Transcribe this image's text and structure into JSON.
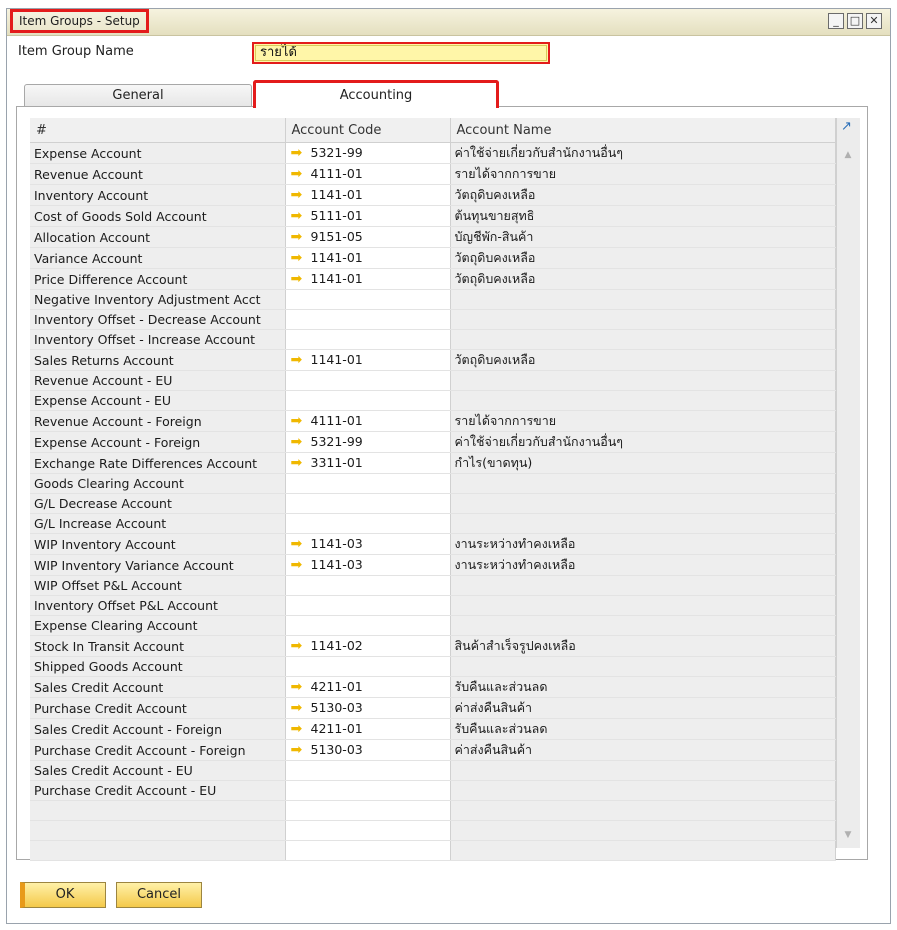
{
  "window": {
    "title": "Item Groups - Setup",
    "minimize": "_",
    "maximize": "□",
    "close": "✕"
  },
  "form": {
    "item_group_name_label": "Item Group Name",
    "item_group_name_value": "รายได้"
  },
  "tabs": [
    {
      "label": "General"
    },
    {
      "label": "Accounting"
    }
  ],
  "table": {
    "headers": [
      "#",
      "Account Code",
      "Account Name"
    ],
    "rows": [
      {
        "name": "Expense Account",
        "code": "5321-99",
        "desc": "ค่าใช้จ่ายเกี่ยวกับสำนักงานอื่นๆ"
      },
      {
        "name": "Revenue Account",
        "code": "4111-01",
        "desc": "รายได้จากการขาย"
      },
      {
        "name": "Inventory Account",
        "code": "1141-01",
        "desc": "วัตถุดิบคงเหลือ"
      },
      {
        "name": "Cost of Goods Sold Account",
        "code": "5111-01",
        "desc": "ต้นทุนขายสุทธิ"
      },
      {
        "name": "Allocation Account",
        "code": "9151-05",
        "desc": "บัญชีพัก-สินค้า"
      },
      {
        "name": "Variance Account",
        "code": "1141-01",
        "desc": "วัตถุดิบคงเหลือ"
      },
      {
        "name": "Price Difference Account",
        "code": "1141-01",
        "desc": "วัตถุดิบคงเหลือ"
      },
      {
        "name": "Negative Inventory Adjustment Acct",
        "code": "",
        "desc": ""
      },
      {
        "name": "Inventory Offset - Decrease Account",
        "code": "",
        "desc": ""
      },
      {
        "name": "Inventory Offset - Increase Account",
        "code": "",
        "desc": ""
      },
      {
        "name": "Sales Returns Account",
        "code": "1141-01",
        "desc": "วัตถุดิบคงเหลือ"
      },
      {
        "name": "Revenue Account - EU",
        "code": "",
        "desc": ""
      },
      {
        "name": "Expense Account - EU",
        "code": "",
        "desc": ""
      },
      {
        "name": "Revenue Account - Foreign",
        "code": "4111-01",
        "desc": "รายได้จากการขาย"
      },
      {
        "name": "Expense Account - Foreign",
        "code": "5321-99",
        "desc": "ค่าใช้จ่ายเกี่ยวกับสำนักงานอื่นๆ"
      },
      {
        "name": "Exchange Rate Differences Account",
        "code": "3311-01",
        "desc": "กำไร(ขาดทุน)"
      },
      {
        "name": "Goods Clearing Account",
        "code": "",
        "desc": ""
      },
      {
        "name": "G/L Decrease Account",
        "code": "",
        "desc": ""
      },
      {
        "name": "G/L Increase Account",
        "code": "",
        "desc": ""
      },
      {
        "name": "WIP Inventory Account",
        "code": "1141-03",
        "desc": "งานระหว่างทำคงเหลือ"
      },
      {
        "name": "WIP Inventory Variance Account",
        "code": "1141-03",
        "desc": "งานระหว่างทำคงเหลือ"
      },
      {
        "name": "WIP Offset P&L Account",
        "code": "",
        "desc": ""
      },
      {
        "name": "Inventory Offset P&L Account",
        "code": "",
        "desc": ""
      },
      {
        "name": "Expense Clearing Account",
        "code": "",
        "desc": ""
      },
      {
        "name": "Stock In Transit Account",
        "code": "1141-02",
        "desc": "สินค้าสำเร็จรูปคงเหลือ"
      },
      {
        "name": "Shipped Goods Account",
        "code": "",
        "desc": ""
      },
      {
        "name": "Sales Credit Account",
        "code": "4211-01",
        "desc": "รับคืนและส่วนลด"
      },
      {
        "name": "Purchase Credit Account",
        "code": "5130-03",
        "desc": "ค่าส่งคืนสินค้า"
      },
      {
        "name": "Sales Credit Account - Foreign",
        "code": "4211-01",
        "desc": "รับคืนและส่วนลด"
      },
      {
        "name": "Purchase Credit Account - Foreign",
        "code": "5130-03",
        "desc": "ค่าส่งคืนสินค้า"
      },
      {
        "name": "Sales Credit Account - EU",
        "code": "",
        "desc": ""
      },
      {
        "name": "Purchase Credit Account - EU",
        "code": "",
        "desc": ""
      },
      {
        "name": "",
        "code": "",
        "desc": ""
      },
      {
        "name": "",
        "code": "",
        "desc": ""
      },
      {
        "name": "",
        "code": "",
        "desc": ""
      }
    ]
  },
  "buttons": {
    "ok": "OK",
    "cancel": "Cancel"
  },
  "icons": {
    "link_arrow": "yellow-right-arrow-icon",
    "expand": "expand-icon"
  },
  "colors": {
    "highlight_red": "#e31b1b",
    "input_yellow": "#fff6a8",
    "arrow_yellow": "#f0b800"
  }
}
